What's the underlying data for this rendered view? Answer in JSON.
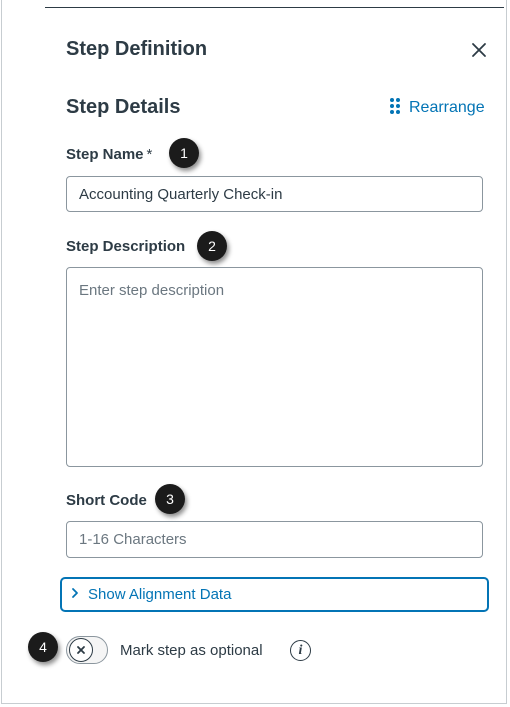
{
  "panel": {
    "title": "Step Definition",
    "close_icon": "close-icon"
  },
  "details": {
    "title": "Step Details",
    "rearrange_label": "Rearrange",
    "rearrange_icon": "drag-dots-icon"
  },
  "step_name": {
    "label": "Step Name",
    "required_mark": "*",
    "value": "Accounting Quarterly Check-in",
    "callout": "1"
  },
  "step_description": {
    "label": "Step Description",
    "placeholder": "Enter step description",
    "value": "",
    "callout": "2"
  },
  "short_code": {
    "label": "Short Code",
    "placeholder": "1-16 Characters",
    "value": "",
    "callout": "3"
  },
  "alignment": {
    "label": "Show Alignment Data",
    "icon": "chevron-right-icon"
  },
  "optional": {
    "label": "Mark step as optional",
    "callout": "4",
    "checked": false,
    "info_glyph": "i"
  },
  "colors": {
    "link": "#0374b5",
    "text": "#2d3b45",
    "callout_bg": "#1b1b1b"
  }
}
